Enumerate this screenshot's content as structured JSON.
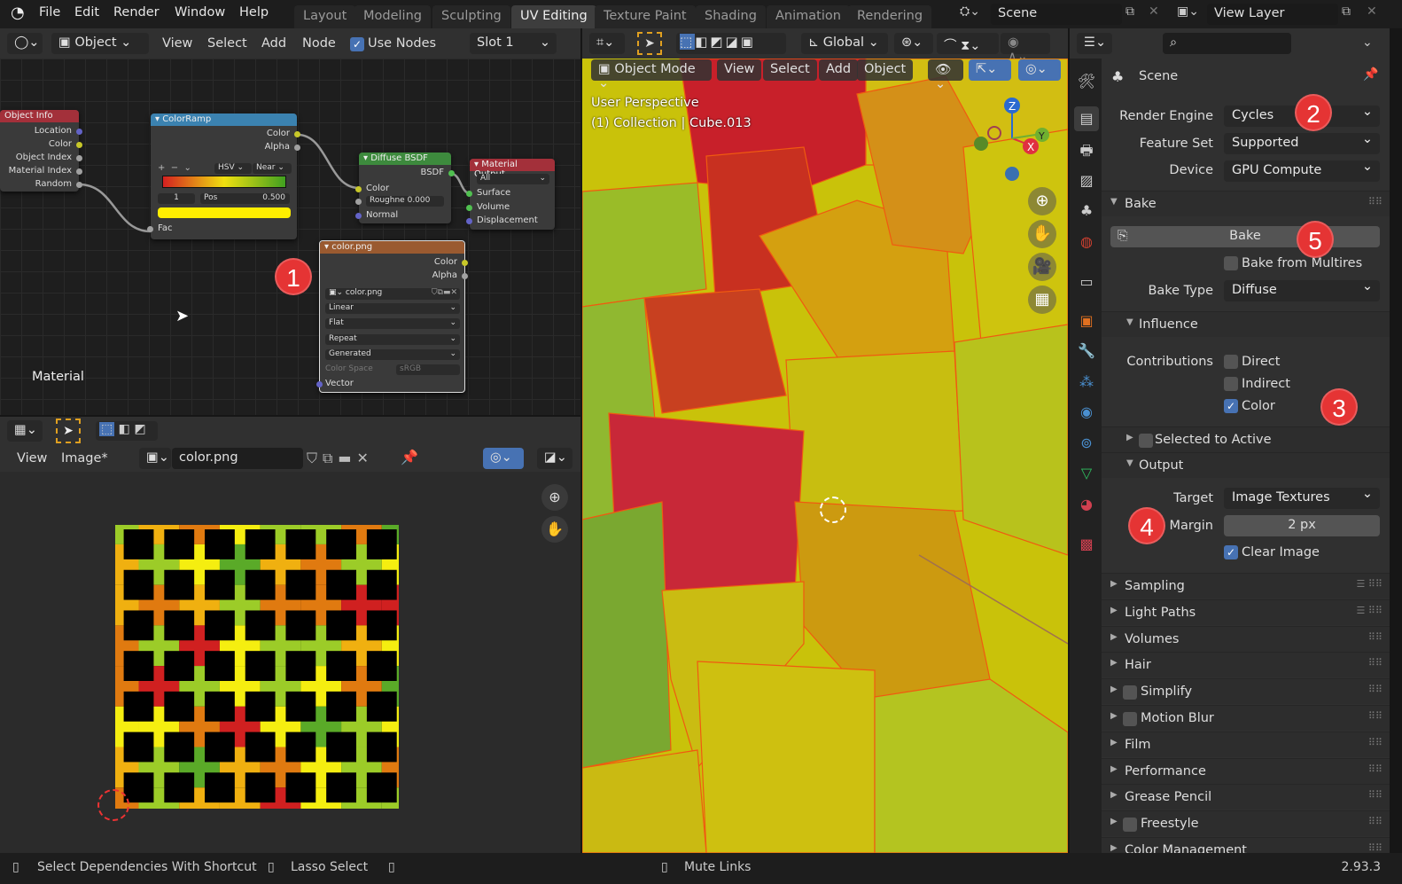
{
  "topbar": {
    "menus": [
      "File",
      "Edit",
      "Render",
      "Window",
      "Help"
    ],
    "workspaces": [
      "Layout",
      "Modeling",
      "Sculpting",
      "UV Editing",
      "Texture Paint",
      "Shading",
      "Animation",
      "Rendering"
    ],
    "active_workspace": "UV Editing",
    "scene": "Scene",
    "view_layer": "View Layer"
  },
  "node_editor": {
    "header": {
      "mode": "Object",
      "menus": [
        "View",
        "Select",
        "Add",
        "Node"
      ],
      "use_nodes_label": "Use Nodes",
      "use_nodes": true,
      "slot": "Slot 1"
    },
    "tree_label": "Material",
    "nodes": {
      "object_info": {
        "title": "Object Info",
        "outputs": [
          "Location",
          "Color",
          "Object Index",
          "Material Index",
          "Random"
        ]
      },
      "color_ramp": {
        "title": "ColorRamp",
        "outputs": [
          "Color",
          "Alpha"
        ],
        "color_mode": "HSV",
        "interpolation": "Near",
        "index": "1",
        "pos_label": "Pos",
        "pos_value": "0.500",
        "input": "Fac",
        "selected_color": "#ffee00"
      },
      "diffuse": {
        "title": "Diffuse BSDF",
        "output": "BSDF",
        "inputs": [
          "Color",
          "Normal"
        ],
        "roughness_label": "Roughne",
        "roughness": "0.000"
      },
      "material_output": {
        "title": "Material Output",
        "target": "All",
        "inputs": [
          "Surface",
          "Volume",
          "Displacement"
        ]
      },
      "image_texture": {
        "title": "color.png",
        "outputs": [
          "Color",
          "Alpha"
        ],
        "image": "color.png",
        "interpolation": "Linear",
        "projection": "Flat",
        "extension": "Repeat",
        "source": "Generated",
        "color_space_label": "Color Space",
        "color_space": "sRGB",
        "input": "Vector"
      }
    }
  },
  "image_editor": {
    "menus": [
      "View",
      "Image*"
    ],
    "image_name": "color.png",
    "palette": [
      "#e07a10",
      "#f5ee10",
      "#9ccc28",
      "#f0b010",
      "#5aaa28",
      "#d02020"
    ]
  },
  "viewport": {
    "mode": "Object Mode",
    "menus": [
      "View",
      "Select",
      "Add",
      "Object"
    ],
    "transform": "Global",
    "overlay_title": "User Perspective",
    "overlay_subtitle": "(1) Collection | Cube.013",
    "axes": [
      "X",
      "Y",
      "Z"
    ]
  },
  "properties": {
    "title": "Scene",
    "render_engine_label": "Render Engine",
    "render_engine": "Cycles",
    "feature_set_label": "Feature Set",
    "feature_set": "Supported",
    "device_label": "Device",
    "device": "GPU Compute",
    "bake": {
      "title": "Bake",
      "button": "Bake",
      "from_multires": "Bake from Multires",
      "from_multires_checked": false,
      "bake_type_label": "Bake Type",
      "bake_type": "Diffuse",
      "influence": "Influence",
      "contributions_label": "Contributions",
      "direct": "Direct",
      "direct_checked": false,
      "indirect": "Indirect",
      "indirect_checked": false,
      "color": "Color",
      "color_checked": true,
      "selected_to_active": "Selected to Active",
      "selected_to_active_checked": false,
      "output": "Output",
      "target_label": "Target",
      "target": "Image Textures",
      "margin_label": "Margin",
      "margin": "2 px",
      "clear_image": "Clear Image",
      "clear_image_checked": true
    },
    "sections": [
      {
        "label": "Sampling",
        "check": false
      },
      {
        "label": "Light Paths",
        "check": false
      },
      {
        "label": "Volumes",
        "check": false
      },
      {
        "label": "Hair",
        "check": false
      },
      {
        "label": "Simplify",
        "check": true
      },
      {
        "label": "Motion Blur",
        "check": true
      },
      {
        "label": "Film",
        "check": false
      },
      {
        "label": "Performance",
        "check": false
      },
      {
        "label": "Grease Pencil",
        "check": false
      },
      {
        "label": "Freestyle",
        "check": true
      },
      {
        "label": "Color Management",
        "check": false
      }
    ]
  },
  "annotations": [
    "1",
    "2",
    "3",
    "4",
    "5"
  ],
  "status": {
    "left": "Select Dependencies With Shortcut",
    "middle": "Lasso Select",
    "center": "Mute Links",
    "version": "2.93.3"
  }
}
